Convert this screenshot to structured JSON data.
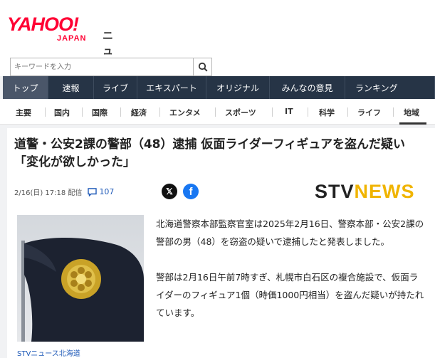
{
  "header": {
    "logo_main": "YAHOO!",
    "logo_sub": "JAPAN",
    "logo_service": "ニュース"
  },
  "search": {
    "placeholder": "キーワードを入力",
    "icon": "search-icon"
  },
  "main_nav": [
    {
      "label": "トップ",
      "active": true
    },
    {
      "label": "速報"
    },
    {
      "label": "ライブ"
    },
    {
      "label": "エキスパート"
    },
    {
      "label": "オリジナル"
    },
    {
      "label": "みんなの意見"
    },
    {
      "label": "ランキング"
    }
  ],
  "sub_nav": [
    {
      "label": "主要"
    },
    {
      "label": "国内"
    },
    {
      "label": "国際"
    },
    {
      "label": "経済"
    },
    {
      "label": "エンタメ"
    },
    {
      "label": "スポーツ"
    },
    {
      "label": "IT"
    },
    {
      "label": "科学"
    },
    {
      "label": "ライフ"
    },
    {
      "label": "地域",
      "active": true
    }
  ],
  "article": {
    "title": "道警・公安2課の警部（48）逮捕 仮面ライダーフィギュアを盗んだ疑い 「変化が欲しかった」",
    "datetime": "2/16(日) 17:18 配信",
    "comment_count": "107",
    "provider_logo_a": "STV",
    "provider_logo_b": "NEWS",
    "photo_caption": "STVニュース北海道",
    "paragraphs": [
      "北海道警察本部監察官室は2025年2月16日、警察本部・公安2課の警部の男（48）を窃盗の疑いで逮捕したと発表しました。",
      "警部は2月16日午前7時すぎ、札幌市白石区の複合施設で、仮面ライダーのフィギュア1個（時価1000円相当）を盗んだ疑いが持たれています。"
    ]
  },
  "colors": {
    "brand_red": "#ff0033",
    "nav_bg": "#263446",
    "link_blue": "#1f5ab8",
    "stv_yellow": "#f0b400"
  }
}
